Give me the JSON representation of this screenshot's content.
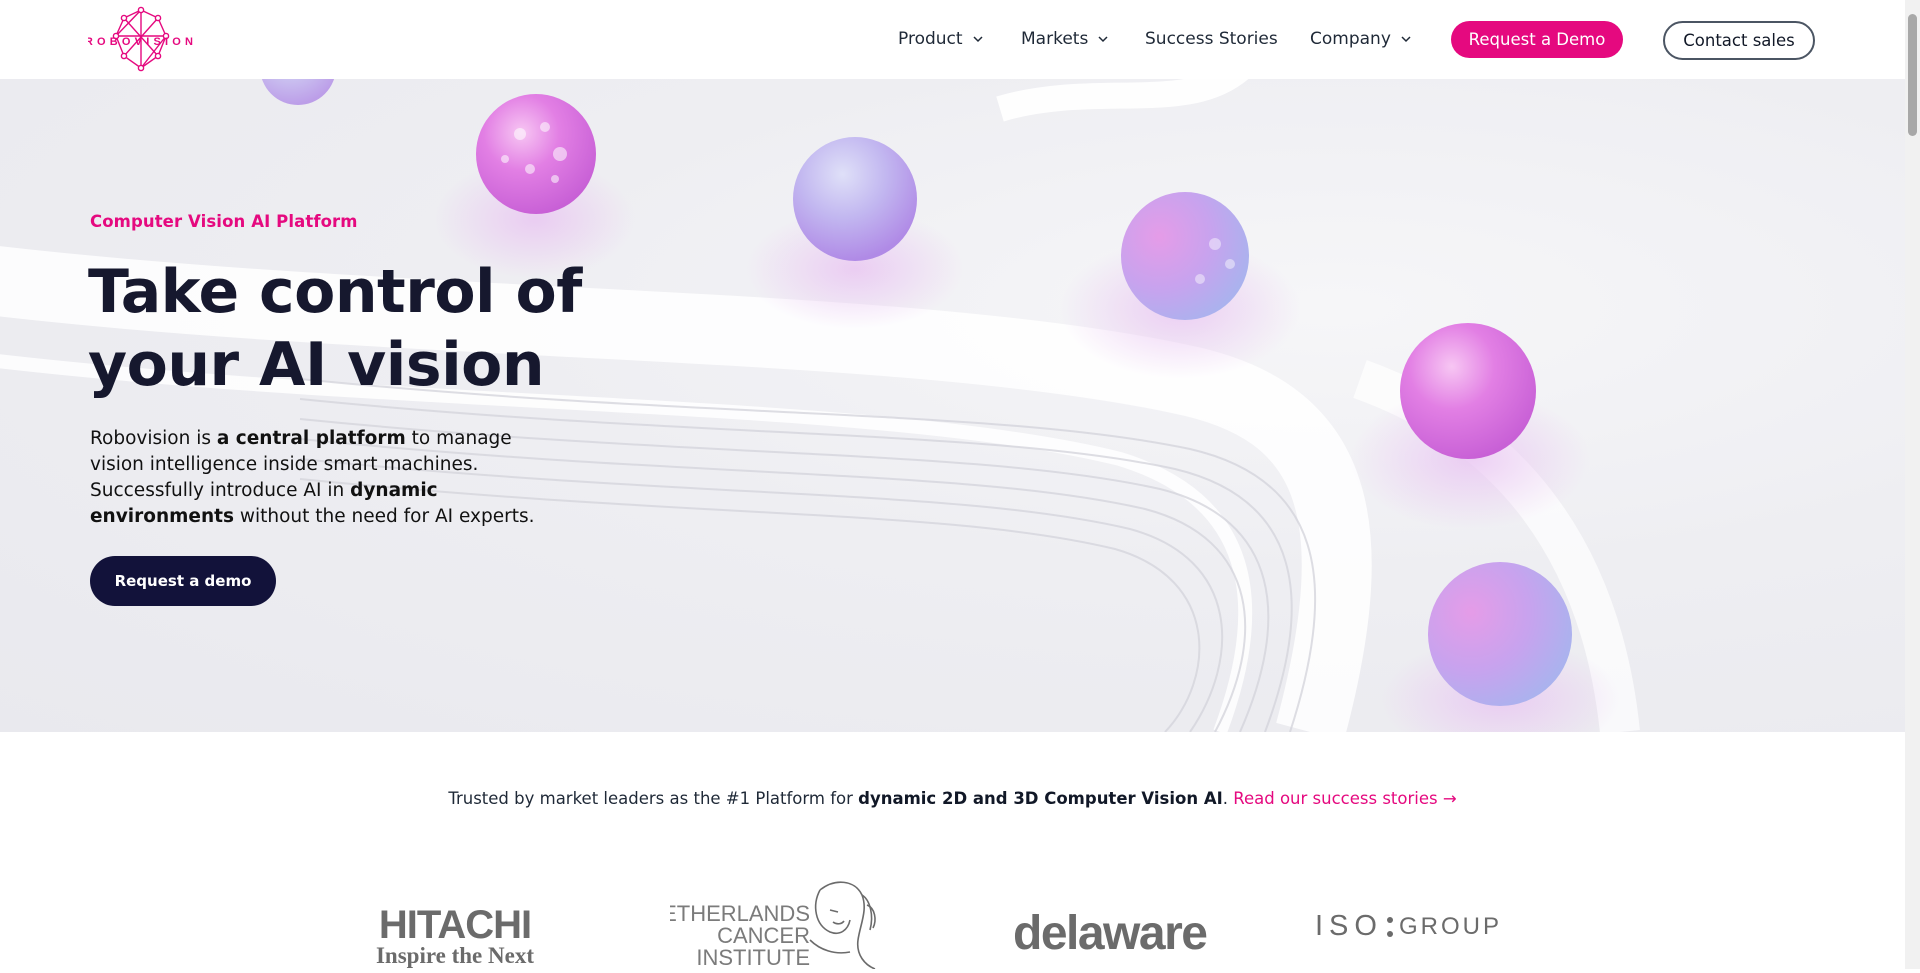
{
  "brand": {
    "name": "Robovision",
    "logo_text": "ROBOVISION"
  },
  "nav": {
    "items": [
      {
        "label": "Product",
        "has_dropdown": true
      },
      {
        "label": "Markets",
        "has_dropdown": true
      },
      {
        "label": "Success Stories",
        "has_dropdown": false
      },
      {
        "label": "Company",
        "has_dropdown": true
      }
    ],
    "demo_button": "Request a Demo",
    "contact_button": "Contact sales"
  },
  "hero": {
    "eyebrow": "Computer Vision AI Platform",
    "headline": "Take control of your AI vision",
    "intro_parts": [
      {
        "text": "Robovision is ",
        "bold": false
      },
      {
        "text": "a central platform",
        "bold": true
      },
      {
        "text": " to manage vision intelligence inside smart machines. Successfully introduce AI in ",
        "bold": false
      },
      {
        "text": "dynamic environments",
        "bold": true
      },
      {
        "text": " without the need for AI experts.",
        "bold": false
      }
    ],
    "cta": "Request a demo"
  },
  "trusted": {
    "prefix": "Trusted by market leaders as the #1 Platform for ",
    "emphasis": "dynamic 2D and 3D Computer Vision AI",
    "suffix": ". ",
    "link": "Read our success stories →"
  },
  "client_logos": {
    "hitachi_line1": "HITACHI",
    "hitachi_line2": "Inspire the Next",
    "nki_line1": "NETHERLANDS",
    "nki_line2": "CANCER",
    "nki_line3": "INSTITUTE",
    "delaware": "delaware",
    "isogroup_iso": "ISO",
    "isogroup_group": "GROUP"
  },
  "colors": {
    "accent": "#e5097f",
    "dark_navy": "#12123a",
    "headline": "#16182e"
  }
}
